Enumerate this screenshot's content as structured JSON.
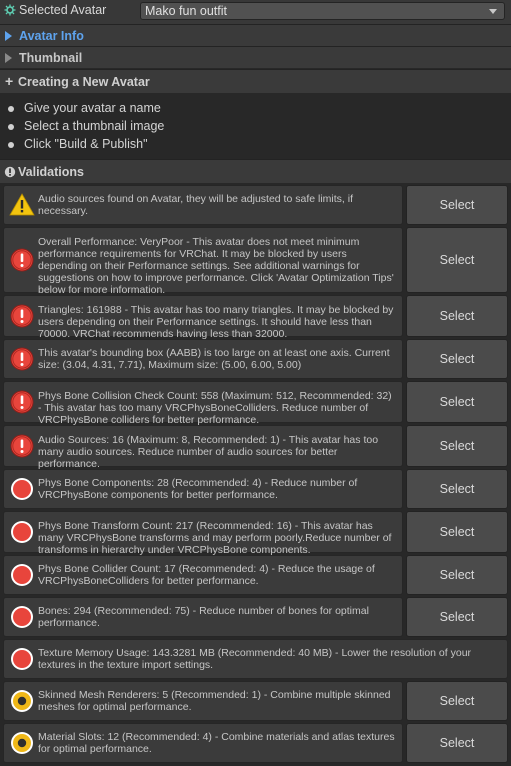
{
  "header": {
    "label": "Selected Avatar",
    "selected_value": "Mako fun outfit"
  },
  "foldouts": [
    {
      "label": "Avatar Info"
    },
    {
      "label": "Thumbnail"
    }
  ],
  "creating": {
    "prefix": "+",
    "title": "Creating a New Avatar",
    "steps": [
      "Give your avatar a name",
      "Select a thumbnail image",
      "Click \"Build & Publish\""
    ]
  },
  "validations": {
    "title": "Validations",
    "select_label": "Select",
    "items": [
      {
        "severity": "warning",
        "message": "Audio sources found on Avatar, they will be adjusted to safe limits, if necessary.",
        "has_button": true
      },
      {
        "severity": "error",
        "message": "Overall Performance: VeryPoor - This avatar does not meet minimum performance requirements for VRChat. It may be blocked by users depending on their Performance settings. See additional warnings for suggestions on how to improve performance. Click 'Avatar Optimization Tips' below for more information.",
        "has_button": true
      },
      {
        "severity": "error",
        "message": "Triangles: 161988 - This avatar has too many triangles. It may be blocked by users depending on their Performance settings. It should have less than 70000. VRChat recommends having less than 32000.",
        "has_button": true
      },
      {
        "severity": "error",
        "message": "This avatar's bounding box (AABB) is too large on at least one axis. Current size: (3.04, 4.31, 7.71), Maximum size: (5.00, 6.00, 5.00)",
        "has_button": true
      },
      {
        "severity": "error",
        "message": "Phys Bone Collision Check Count: 558 (Maximum: 512, Recommended: 32) - This avatar has too many VRCPhysBoneColliders. Reduce number of VRCPhysBone colliders for better performance.",
        "has_button": true
      },
      {
        "severity": "error",
        "message": "Audio Sources: 16 (Maximum: 8, Recommended: 1) - This avatar has too many audio sources. Reduce number of audio sources for better performance.",
        "has_button": true
      },
      {
        "severity": "verypoor",
        "message": "Phys Bone Components: 28 (Recommended: 4) - Reduce number of VRCPhysBone components for better performance.",
        "has_button": true
      },
      {
        "severity": "verypoor",
        "message": "Phys Bone Transform Count: 217 (Recommended: 16) - This avatar has many VRCPhysBone transforms and may perform poorly.Reduce number of transforms in hierarchy under VRCPhysBone components.",
        "has_button": true
      },
      {
        "severity": "verypoor",
        "message": "Phys Bone Collider Count: 17 (Recommended: 4) - Reduce the usage of VRCPhysBoneColliders for better performance.",
        "has_button": true
      },
      {
        "severity": "verypoor",
        "message": "Bones: 294 (Recommended: 75) - Reduce number of bones for optimal performance.",
        "has_button": true
      },
      {
        "severity": "verypoor",
        "message": "Texture Memory Usage: 143.3281 MB (Recommended: 40 MB) - Lower the resolution of your textures in the texture import settings.",
        "has_button": false
      },
      {
        "severity": "poor",
        "message": "Skinned Mesh Renderers: 5 (Recommended: 1) - Combine multiple skinned meshes for optimal performance.",
        "has_button": true
      },
      {
        "severity": "poor",
        "message": "Material Slots: 12 (Recommended: 4) - Combine materials and atlas textures for optimal performance.",
        "has_button": true
      }
    ]
  },
  "colors": {
    "accent": "#5ea3ee",
    "warning": "#f2c40f",
    "error": "#e8453c",
    "poor": "#f0b818"
  }
}
